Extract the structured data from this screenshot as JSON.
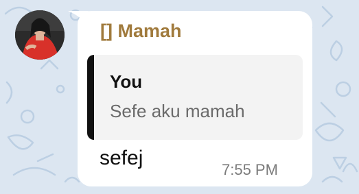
{
  "message": {
    "sender_name": "[] Mamah",
    "reply": {
      "author": "You",
      "text": "Sefe aku mamah"
    },
    "text": "sefej",
    "time": "7:55 PM"
  },
  "colors": {
    "wallpaper": "#dce6f1",
    "bubble": "#ffffff",
    "sender_name": "#a07a3c",
    "reply_bar": "#111111",
    "reply_background": "#f3f3f3"
  },
  "icons": {
    "avatar": "contact-photo"
  }
}
